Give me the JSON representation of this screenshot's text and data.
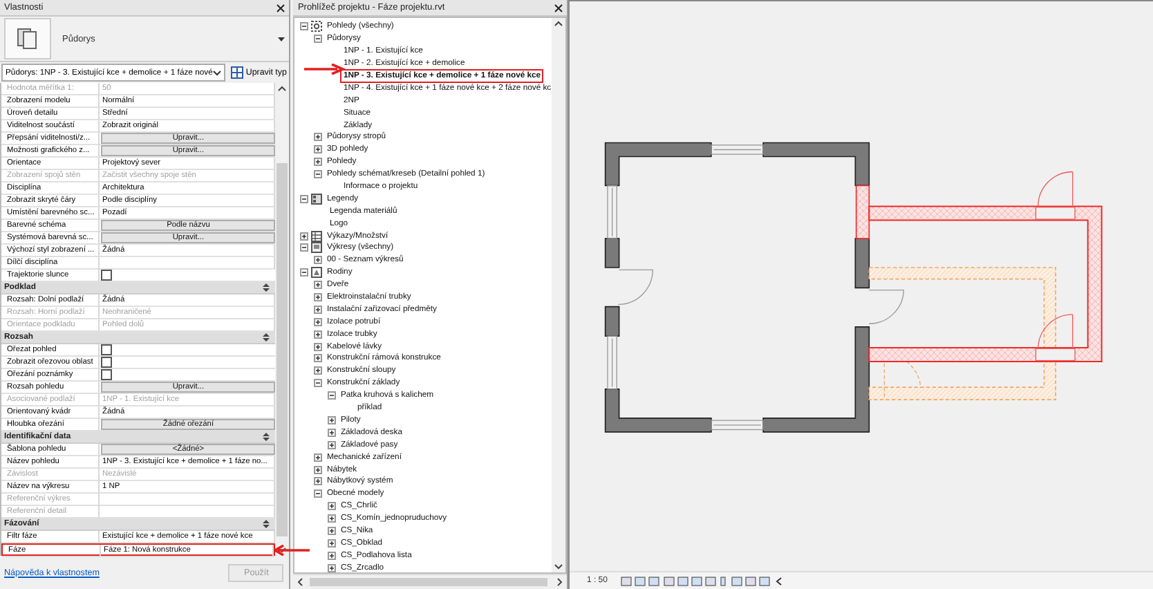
{
  "properties": {
    "title": "Vlastnosti",
    "type_name": "Půdorys",
    "type_selector": "Půdorys: 1NP - 3. Existující kce + demolice + 1 fáze nové",
    "edit_type": "Upravit typ",
    "rows": [
      {
        "kind": "text",
        "label": "Hodnota měřítka   1:",
        "value": "50",
        "disabled": true,
        "highlighted": false
      },
      {
        "kind": "text",
        "label": "Zobrazení modelu",
        "value": "Normální",
        "disabled": false,
        "highlighted": false
      },
      {
        "kind": "text",
        "label": "Úroveň detailu",
        "value": "Střední",
        "disabled": false,
        "highlighted": false
      },
      {
        "kind": "text",
        "label": "Viditelnost součástí",
        "value": "Zobrazit originál",
        "disabled": false,
        "highlighted": false
      },
      {
        "kind": "button",
        "label": "Přepsání viditelnosti/z...",
        "value": "Upravit...",
        "disabled": false,
        "highlighted": false
      },
      {
        "kind": "button",
        "label": "Možnosti grafického z...",
        "value": "Upravit...",
        "disabled": false,
        "highlighted": false
      },
      {
        "kind": "text",
        "label": "Orientace",
        "value": "Projektový sever",
        "disabled": false,
        "highlighted": false
      },
      {
        "kind": "text",
        "label": "Zobrazení spojů stěn",
        "value": "Začistit všechny spoje stěn",
        "disabled": true,
        "highlighted": false
      },
      {
        "kind": "text",
        "label": "Disciplína",
        "value": "Architektura",
        "disabled": false,
        "highlighted": false
      },
      {
        "kind": "text",
        "label": "Zobrazit skryté čáry",
        "value": "Podle disciplíny",
        "disabled": false,
        "highlighted": false
      },
      {
        "kind": "text",
        "label": "Umístění barevného sc...",
        "value": "Pozadí",
        "disabled": false,
        "highlighted": false
      },
      {
        "kind": "button",
        "label": "Barevné schéma",
        "value": "Podle názvu",
        "disabled": false,
        "highlighted": false
      },
      {
        "kind": "button",
        "label": "Systémová barevná sc...",
        "value": "Upravit...",
        "disabled": false,
        "highlighted": false
      },
      {
        "kind": "text",
        "label": "Výchozí styl zobrazení ...",
        "value": "Žádná",
        "disabled": false,
        "highlighted": false
      },
      {
        "kind": "text",
        "label": "Dílčí disciplína",
        "disabled": false,
        "highlighted": false
      },
      {
        "kind": "checkbox",
        "label": "Trajektorie slunce",
        "checked": false,
        "disabled": false,
        "highlighted": false
      },
      {
        "kind": "section",
        "label": "Podklad"
      },
      {
        "kind": "text",
        "label": "Rozsah: Dolní podlaží",
        "value": "Žádná",
        "disabled": false,
        "highlighted": false
      },
      {
        "kind": "text",
        "label": "Rozsah: Horní podlaží",
        "value": "Neohraničené",
        "disabled": true,
        "highlighted": false
      },
      {
        "kind": "text",
        "label": "Orientace podkladu",
        "value": "Pohled dolů",
        "disabled": true,
        "highlighted": false
      },
      {
        "kind": "section",
        "label": "Rozsah"
      },
      {
        "kind": "checkbox",
        "label": "Ořezat pohled",
        "checked": false,
        "disabled": false,
        "highlighted": false
      },
      {
        "kind": "checkbox",
        "label": "Zobrazit ořezovou oblast",
        "checked": false,
        "disabled": false,
        "highlighted": false
      },
      {
        "kind": "checkbox",
        "label": "Ořezání poznámky",
        "checked": false,
        "disabled": false,
        "highlighted": false
      },
      {
        "kind": "button",
        "label": "Rozsah pohledu",
        "value": "Upravit...",
        "disabled": false,
        "highlighted": false
      },
      {
        "kind": "text",
        "label": "Asociované podlaží",
        "value": "1NP - 1. Existující kce",
        "disabled": true,
        "highlighted": false
      },
      {
        "kind": "text",
        "label": "Orientovaný kvádr",
        "value": "Žádná",
        "disabled": false,
        "highlighted": false
      },
      {
        "kind": "button",
        "label": "Hloubka ořezání",
        "value": "Žádné ořezání",
        "disabled": false,
        "highlighted": false
      },
      {
        "kind": "section",
        "label": "Identifikační data"
      },
      {
        "kind": "button",
        "label": "Šablona pohledu",
        "value": "<Žádné>",
        "disabled": false,
        "highlighted": false
      },
      {
        "kind": "text",
        "label": "Název pohledu",
        "value": "1NP - 3. Existující kce + demolice + 1 fáze no...",
        "disabled": false,
        "highlighted": false
      },
      {
        "kind": "text",
        "label": "Závislost",
        "value": "Nezávislé",
        "disabled": true,
        "highlighted": false
      },
      {
        "kind": "text",
        "label": "Název na výkresu",
        "value": "1 NP",
        "disabled": false,
        "highlighted": false
      },
      {
        "kind": "text",
        "label": "Referenční výkres",
        "disabled": true,
        "highlighted": false
      },
      {
        "kind": "text",
        "label": "Referenční detail",
        "disabled": true,
        "highlighted": false
      },
      {
        "kind": "section",
        "label": "Fázování"
      },
      {
        "kind": "text",
        "label": "Filtr fáze",
        "value": "Existující kce + demolice + 1 fáze nové kce",
        "disabled": false,
        "highlighted": false
      },
      {
        "kind": "text",
        "label": "Fáze",
        "value": "Fáze 1: Nová konstrukce",
        "disabled": false,
        "highlighted": true
      }
    ],
    "help_link": "Nápověda k vlastnostem",
    "apply": "Použít"
  },
  "browser": {
    "title": "Prohlížeč projektu - Fáze projektu.rvt",
    "tree": [
      {
        "label": "Pohledy (všechny)",
        "kind": "node",
        "expanded": true,
        "selected": false,
        "children": [
          {
            "label": "Půdorysy",
            "kind": "node",
            "expanded": true,
            "selected": false,
            "children": [
              {
                "label": "1NP - 1. Existující kce",
                "kind": "leaf",
                "selected": false
              },
              {
                "label": "1NP - 2. Existující kce + demolice",
                "kind": "leaf",
                "selected": false
              },
              {
                "label": "1NP - 3. Existující kce + demolice + 1 fáze nové kce",
                "kind": "leaf",
                "selected": true
              },
              {
                "label": "1NP - 4. Existující kce + 1 fáze nové kce + 2 fáze nové kc",
                "kind": "leaf",
                "selected": false
              },
              {
                "label": "2NP",
                "kind": "leaf",
                "selected": false
              },
              {
                "label": "Situace",
                "kind": "leaf",
                "selected": false
              },
              {
                "label": "Základy",
                "kind": "leaf",
                "selected": false
              }
            ]
          },
          {
            "label": "Půdorysy stropů",
            "kind": "node",
            "expanded": false,
            "selected": false
          },
          {
            "label": "3D pohledy",
            "kind": "node",
            "expanded": false,
            "selected": false
          },
          {
            "label": "Pohledy",
            "kind": "node",
            "expanded": false,
            "selected": false
          },
          {
            "label": "Pohledy schémat/kreseb (Detailní pohled 1)",
            "kind": "node",
            "expanded": true,
            "selected": false,
            "children": [
              {
                "label": "Informace o projektu",
                "kind": "leaf",
                "selected": false
              }
            ]
          }
        ]
      },
      {
        "label": "Legendy",
        "kind": "node",
        "expanded": true,
        "selected": false,
        "children": [
          {
            "label": "Legenda materiálů",
            "kind": "leaf",
            "selected": false
          },
          {
            "label": "Logo",
            "kind": "leaf",
            "selected": false
          }
        ]
      },
      {
        "label": "Výkazy/Množství",
        "kind": "node",
        "expanded": false,
        "selected": false
      },
      {
        "label": "Výkresy (všechny)",
        "kind": "node",
        "expanded": true,
        "selected": false,
        "children": [
          {
            "label": "00 - Seznam výkresů",
            "kind": "node",
            "expanded": false,
            "selected": false
          }
        ]
      },
      {
        "label": "Rodiny",
        "kind": "node",
        "expanded": true,
        "selected": false,
        "children": [
          {
            "label": "Dveře",
            "kind": "node",
            "expanded": false,
            "selected": false
          },
          {
            "label": "Elektroinstalační trubky",
            "kind": "node",
            "expanded": false,
            "selected": false
          },
          {
            "label": "Instalační zařizovací předměty",
            "kind": "node",
            "expanded": false,
            "selected": false
          },
          {
            "label": "Izolace potrubí",
            "kind": "node",
            "expanded": false,
            "selected": false
          },
          {
            "label": "Izolace trubky",
            "kind": "node",
            "expanded": false,
            "selected": false
          },
          {
            "label": "Kabelové lávky",
            "kind": "node",
            "expanded": false,
            "selected": false
          },
          {
            "label": "Konstrukční rámová konstrukce",
            "kind": "node",
            "expanded": false,
            "selected": false
          },
          {
            "label": "Konstrukční sloupy",
            "kind": "node",
            "expanded": false,
            "selected": false
          },
          {
            "label": "Konstrukční základy",
            "kind": "node",
            "expanded": true,
            "selected": false,
            "children": [
              {
                "label": "Patka kruhová s kalichem",
                "kind": "node",
                "expanded": true,
                "selected": false,
                "children": [
                  {
                    "label": "příklad",
                    "kind": "leaf",
                    "selected": false
                  }
                ]
              },
              {
                "label": "Piloty",
                "kind": "node",
                "expanded": false,
                "selected": false
              },
              {
                "label": "Základová deska",
                "kind": "node",
                "expanded": false,
                "selected": false
              },
              {
                "label": "Základové pasy",
                "kind": "node",
                "expanded": false,
                "selected": false
              }
            ]
          },
          {
            "label": "Mechanické zařízení",
            "kind": "node",
            "expanded": false,
            "selected": false
          },
          {
            "label": "Nábytek",
            "kind": "node",
            "expanded": false,
            "selected": false
          },
          {
            "label": "Nábytkový systém",
            "kind": "node",
            "expanded": false,
            "selected": false
          },
          {
            "label": "Obecné modely",
            "kind": "node",
            "expanded": true,
            "selected": false,
            "children": [
              {
                "label": "CS_Chrlič",
                "kind": "node",
                "expanded": false,
                "selected": false
              },
              {
                "label": "CS_Komín_jednopruduchovy",
                "kind": "node",
                "expanded": false,
                "selected": false
              },
              {
                "label": "CS_Nika",
                "kind": "node",
                "expanded": false,
                "selected": false
              },
              {
                "label": "CS_Obklad",
                "kind": "node",
                "expanded": false,
                "selected": false
              },
              {
                "label": "CS_Podlahova lista",
                "kind": "node",
                "expanded": false,
                "selected": false
              },
              {
                "label": "CS_Zrcadlo",
                "kind": "node",
                "expanded": false,
                "selected": false
              }
            ]
          }
        ]
      }
    ]
  },
  "view": {
    "scale": "1 : 50"
  }
}
